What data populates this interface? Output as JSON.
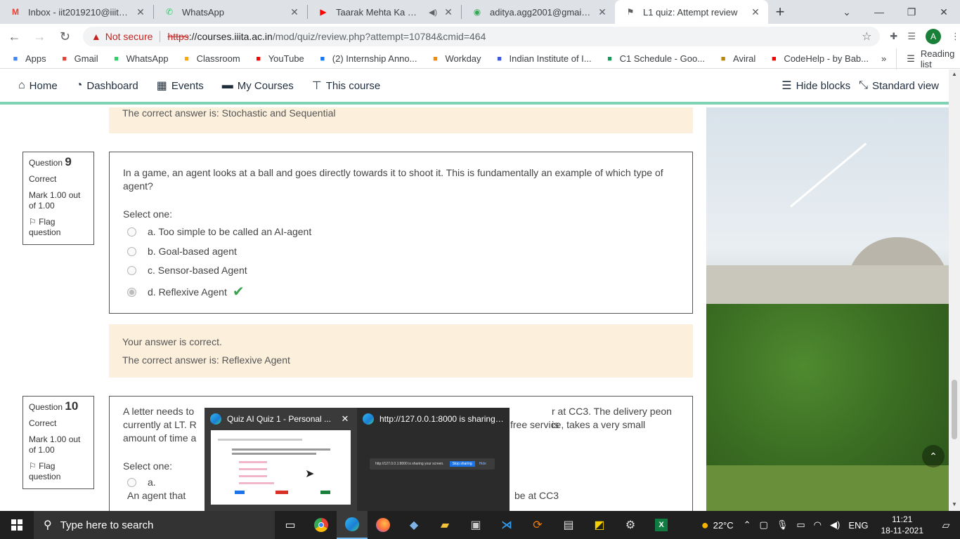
{
  "browser": {
    "tabs": [
      {
        "title": "Inbox - iit2019210@iiita.ac.in",
        "icon": "gmail-icon",
        "active": false
      },
      {
        "title": "WhatsApp",
        "icon": "whatsapp-icon",
        "active": false
      },
      {
        "title": "Taarak Mehta Ka Ooltah",
        "icon": "youtube-icon",
        "active": false
      },
      {
        "title": "aditya.agg2001@gmail.com",
        "icon": "google-icon",
        "active": false
      },
      {
        "title": "L1 quiz: Attempt review",
        "icon": "moodle-icon",
        "active": true
      }
    ],
    "new_tab": "+",
    "address": {
      "security": "Not secure",
      "scheme": "https",
      "host": "://courses.iiita.ac.in",
      "path": "/mod/quiz/review.php?attempt=10784&cmid=464"
    },
    "profile_initial": "A",
    "bookmarks": [
      {
        "label": "Apps",
        "icon": "apps-grid-icon",
        "color": "#4285f4"
      },
      {
        "label": "Gmail",
        "icon": "gmail-icon",
        "color": "#ea4335"
      },
      {
        "label": "WhatsApp",
        "icon": "whatsapp-icon",
        "color": "#25d366"
      },
      {
        "label": "Classroom",
        "icon": "classroom-icon",
        "color": "#f9ab00"
      },
      {
        "label": "YouTube",
        "icon": "youtube-icon",
        "color": "#ff0000"
      },
      {
        "label": "(2) Internship Anno...",
        "icon": "facebook-icon",
        "color": "#1877f2"
      },
      {
        "label": "Workday",
        "icon": "workday-icon",
        "color": "#f38b00"
      },
      {
        "label": "Indian Institute of I...",
        "icon": "iiit-icon",
        "color": "#3b5bdb"
      },
      {
        "label": "C1 Schedule - Goo...",
        "icon": "sheets-icon",
        "color": "#0f9d58"
      },
      {
        "label": "Aviral",
        "icon": "aviral-icon",
        "color": "#b8860b"
      },
      {
        "label": "CodeHelp - by Bab...",
        "icon": "youtube-icon",
        "color": "#ff0000"
      }
    ],
    "bookmarks_more": "»",
    "reading_list": "Reading list"
  },
  "site_nav": {
    "items": [
      {
        "label": "Home",
        "icon": "home-icon"
      },
      {
        "label": "Dashboard",
        "icon": "dashboard-icon"
      },
      {
        "label": "Events",
        "icon": "calendar-icon"
      },
      {
        "label": "My Courses",
        "icon": "briefcase-icon"
      },
      {
        "label": "This course",
        "icon": "sitemap-icon"
      }
    ],
    "hide_blocks": "Hide blocks",
    "standard_view": "Standard view"
  },
  "previous_feedback": {
    "correct_answer": "The correct answer is: Stochastic and Sequential"
  },
  "questions": [
    {
      "label": "Question",
      "number": "9",
      "state": "Correct",
      "mark": "Mark 1.00 out of 1.00",
      "flag": "Flag question",
      "text": "In a game, an agent looks at a ball and goes directly towards it to shoot it. This is fundamentally an example of which type of agent?",
      "prompt": "Select one:",
      "options": [
        {
          "text": "a. Too simple to be called an AI-agent",
          "selected": false
        },
        {
          "text": "b. Goal-based agent",
          "selected": false
        },
        {
          "text": "c. Sensor-based Agent",
          "selected": false
        },
        {
          "text": "d. Reflexive Agent",
          "selected": true
        }
      ],
      "feedback": "Your answer is correct.",
      "correct_answer": "The correct answer is: Reflexive Agent"
    },
    {
      "label": "Question",
      "number": "10",
      "state": "Correct",
      "mark": "Mark 1.00 out of 1.00",
      "flag": "Flag question",
      "text_line1_a": "A letter needs to",
      "text_line1_b": "r at CC3. The delivery peon is",
      "text_line2_a": "currently at LT. R",
      "text_line2_b": "free service, takes a very small",
      "text_line3_a": "amount of time a",
      "prompt": "Select one:",
      "option_a_label": "a.",
      "option_a_text_start": "An agent that",
      "option_a_text_end": "be at CC3"
    }
  ],
  "taskbar_previews": [
    {
      "title": "Quiz AI Quiz 1 - Personal ...",
      "icon": "edge-icon"
    },
    {
      "title": "http://127.0.0.1:8000 is sharing ...",
      "icon": "edge-icon",
      "bar_text": "http://127.0.0.1:8000 is sharing your screen.",
      "stop": "Stop sharing",
      "hide": "Hide"
    }
  ],
  "taskbar": {
    "search_placeholder": "Type here to search",
    "weather": "22°C",
    "language": "ENG",
    "time": "11:21",
    "date": "18-11-2021"
  }
}
